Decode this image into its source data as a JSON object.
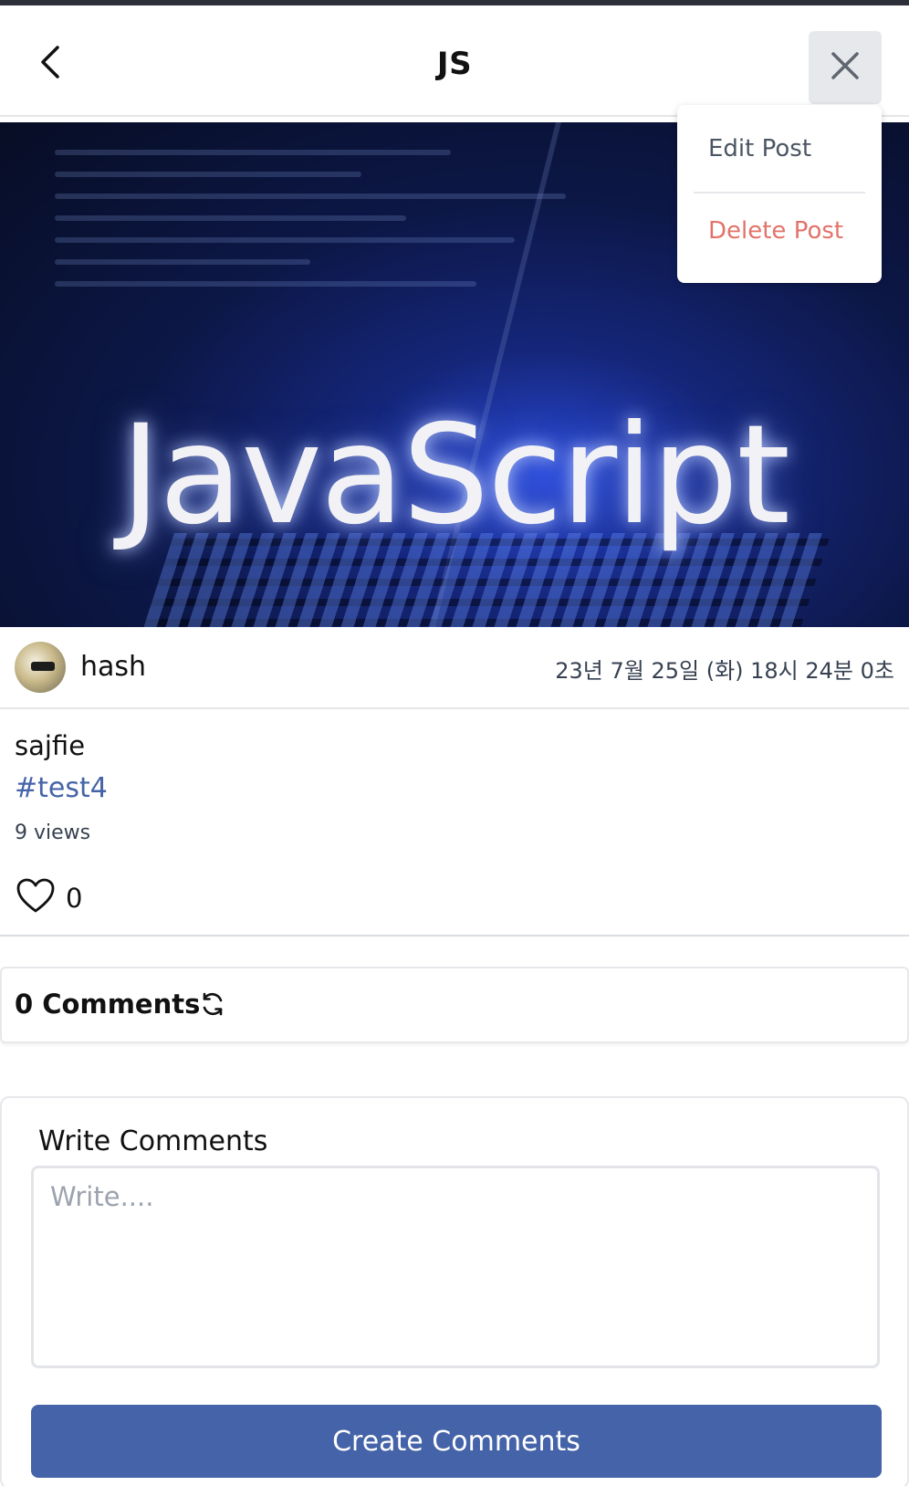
{
  "header": {
    "title": "JS",
    "back_icon": "chevron-left-icon",
    "close_icon": "close-icon"
  },
  "menu": {
    "edit_label": "Edit Post",
    "delete_label": "Delete Post",
    "delete_color": "#e2736a"
  },
  "post": {
    "cover_text": "JavaScript",
    "author": "hash",
    "date": "23년 7월 25일 (화) 18시 24분 0초",
    "body": "sajfie",
    "hashtag": "#test4",
    "views": "9 views",
    "likes": "0",
    "like_icon": "heart-outline-icon"
  },
  "comments": {
    "count_label": "0 Comments",
    "refresh_icon": "refresh-icon"
  },
  "write": {
    "label": "Write Comments",
    "placeholder": "Write....",
    "value": "",
    "submit_label": "Create Comments"
  },
  "colors": {
    "accent": "#4563a8",
    "danger": "#e2736a",
    "close_bg": "#e6e8ec"
  }
}
